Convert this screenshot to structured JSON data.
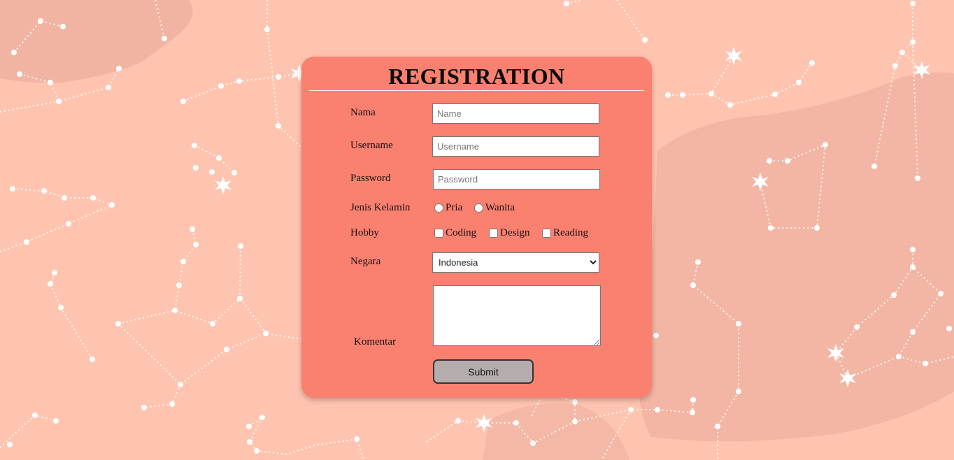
{
  "form": {
    "title": "REGISTRATION",
    "nama": {
      "label": "Nama",
      "placeholder": "Name",
      "value": ""
    },
    "username": {
      "label": "Username",
      "placeholder": "Username",
      "value": ""
    },
    "password": {
      "label": "Password",
      "placeholder": "Password",
      "value": ""
    },
    "gender": {
      "label": "Jenis Kelamin",
      "options": [
        "Pria",
        "Wanita"
      ]
    },
    "hobby": {
      "label": "Hobby",
      "options": [
        "Coding",
        "Design",
        "Reading"
      ]
    },
    "negara": {
      "label": "Negara",
      "selected": "Indonesia"
    },
    "komentar": {
      "label": "Komentar",
      "value": ""
    },
    "submit_label": "Submit"
  },
  "colors": {
    "background": "#ffc4b0",
    "card": "#fa8070",
    "button": "#b5adad"
  }
}
